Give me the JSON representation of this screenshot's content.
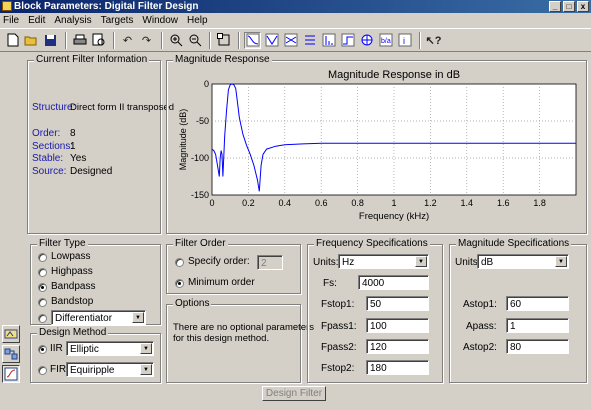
{
  "window": {
    "title": "Block Parameters: Digital Filter Design",
    "min": "_",
    "max": "□",
    "close": "x"
  },
  "menu": [
    "File",
    "Edit",
    "Analysis",
    "Targets",
    "Window",
    "Help"
  ],
  "toolbar_icons": [
    "new-icon",
    "open-icon",
    "save-icon",
    "print-icon",
    "print-preview-icon",
    "undo-icon",
    "redo-icon",
    "zoom-in-icon",
    "zoom-out-icon",
    "full-view-icon",
    "magnitude-response-icon",
    "phase-response-icon",
    "mag-phase-icon",
    "group-delay-icon",
    "impulse-response-icon",
    "step-response-icon",
    "pole-zero-icon",
    "filter-coefficients-icon",
    "filter-info-icon",
    "whats-this-icon"
  ],
  "current_filter": {
    "title": "Current Filter Information",
    "structure_label": "Structure:",
    "structure_value": "Direct form II transposed",
    "order_label": "Order:",
    "order_value": "8",
    "sections_label": "Sections:",
    "sections_value": "1",
    "stable_label": "Stable:",
    "stable_value": "Yes",
    "source_label": "Source:",
    "source_value": "Designed"
  },
  "magnitude_panel": {
    "title": "Magnitude Response"
  },
  "chart_data": {
    "type": "line",
    "title": "Magnitude Response in dB",
    "xlabel": "Frequency (kHz)",
    "ylabel": "Magnitude (dB)",
    "xlim": [
      0,
      2
    ],
    "ylim": [
      -150,
      0
    ],
    "xticks": [
      "0",
      "0.2",
      "0.4",
      "0.6",
      "0.8",
      "1",
      "1.2",
      "1.4",
      "1.6",
      "1.8"
    ],
    "yticks": [
      "0",
      "-50",
      "-100",
      "-150"
    ],
    "grid": true,
    "series": [
      {
        "color": "#0000ff",
        "x": [
          0.0,
          0.01,
          0.02,
          0.03,
          0.04,
          0.045,
          0.05,
          0.055,
          0.06,
          0.07,
          0.08,
          0.09,
          0.1,
          0.11,
          0.12,
          0.13,
          0.14,
          0.15,
          0.17,
          0.19,
          0.21,
          0.23,
          0.25,
          0.26,
          0.27,
          0.28,
          0.3,
          0.35,
          0.4,
          0.5,
          0.6,
          0.8,
          1.0,
          1.2,
          1.4,
          1.6,
          1.8,
          2.0
        ],
        "y": [
          -88,
          -90,
          -95,
          -110,
          -125,
          -100,
          -90,
          -95,
          -125,
          -70,
          -35,
          -8,
          -1,
          0,
          -1,
          -6,
          -25,
          -45,
          -68,
          -83,
          -95,
          -110,
          -130,
          -145,
          -110,
          -95,
          -88,
          -84,
          -82,
          -81,
          -80,
          -80,
          -80,
          -80,
          -80,
          -80,
          -80,
          -80
        ]
      }
    ]
  },
  "filter_type": {
    "title": "Filter Type",
    "options": [
      "Lowpass",
      "Highpass",
      "Bandpass",
      "Bandstop"
    ],
    "selected": "Bandpass",
    "other_select": "Differentiator"
  },
  "design_method": {
    "title": "Design Method",
    "iir_label": "IIR",
    "iir_value": "Elliptic",
    "fir_label": "FIR",
    "fir_value": "Equiripple"
  },
  "filter_order": {
    "title": "Filter Order",
    "specify_label": "Specify order:",
    "specify_value": "2",
    "minimum_label": "Minimum order"
  },
  "options": {
    "title": "Options",
    "text_line1": "There are no optional parameters",
    "text_line2": "for this design method."
  },
  "freq_specs": {
    "title": "Frequency Specifications",
    "units_label": "Units:",
    "units_value": "Hz",
    "fs_label": "Fs:",
    "fs_value": "4000",
    "fstop1_label": "Fstop1:",
    "fstop1_value": "50",
    "fpass1_label": "Fpass1:",
    "fpass1_value": "100",
    "fpass2_label": "Fpass2:",
    "fpass2_value": "120",
    "fstop2_label": "Fstop2:",
    "fstop2_value": "180"
  },
  "mag_specs": {
    "title": "Magnitude Specifications",
    "units_label": "Units:",
    "units_value": "dB",
    "astop1_label": "Astop1:",
    "astop1_value": "60",
    "apass_label": "Apass:",
    "apass_value": "1",
    "astop2_label": "Astop2:",
    "astop2_value": "80"
  },
  "design_button": "Design Filter"
}
